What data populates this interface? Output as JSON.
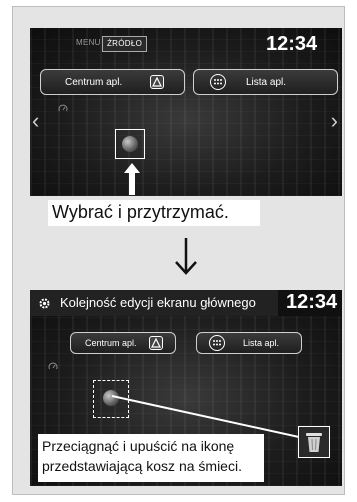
{
  "step1": {
    "top_menu_label": "MENU",
    "top_source_label": "ŹRÓDŁO",
    "clock": "12:34",
    "app_center_label": "Centrum apl.",
    "app_list_label": "Lista apl.",
    "instruction": "Wybrać i przytrzymać."
  },
  "step2": {
    "header_title": "Kolejność edycji ekranu głównego",
    "clock": "12:34",
    "app_center_label": "Centrum apl.",
    "app_list_label": "Lista apl.",
    "instruction_line1": "Przeciągnąć i upuścić na ikonę",
    "instruction_line2": "przedstawiającą kosz na śmieci."
  },
  "icons": {
    "app_center": "triangle-a-icon",
    "app_list": "grid-circle-icon",
    "trash": "trash-icon",
    "settings": "gear-icon",
    "arrow_down": "down-arrow-icon"
  }
}
